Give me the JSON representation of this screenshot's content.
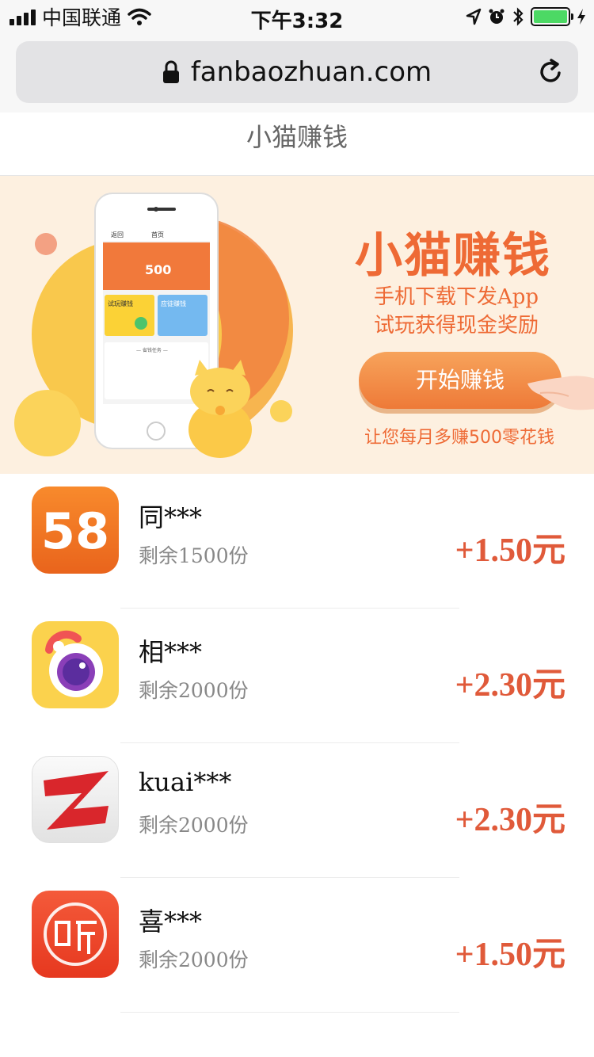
{
  "status_bar": {
    "carrier": "中国联通",
    "time": "下午3:32",
    "battery_color": "#4cd964"
  },
  "browser": {
    "url": "fanbaozhuan.com",
    "lock_icon": "lock-icon",
    "reload_icon": "reload-icon"
  },
  "page": {
    "title": "小猫赚钱"
  },
  "banner": {
    "title": "小猫赚钱",
    "subtitle_line1": "手机下载下发App",
    "subtitle_line2": "试玩获得现金奖励",
    "button_label": "开始赚钱",
    "footer": "让您每月多赚500零花钱",
    "accent_color": "#ee6a35",
    "phone": {
      "back_label": "返回",
      "nav_title": "首页",
      "amount": "500",
      "card1_title": "试玩赚钱",
      "card2_title": "应徒赚钱",
      "section_title": "— 省钱任务 —"
    }
  },
  "tasks": [
    {
      "name": "同***",
      "remaining": "剩余1500份",
      "reward": "+1.50元",
      "icon": "58-app-icon"
    },
    {
      "name": "相***",
      "remaining": "剩余2000份",
      "reward": "+2.30元",
      "icon": "camera-app-icon"
    },
    {
      "name": "kuai***",
      "remaining": "剩余2000份",
      "reward": "+2.30元",
      "icon": "kuaiya-app-icon"
    },
    {
      "name": "喜***",
      "remaining": "剩余2000份",
      "reward": "+1.50元",
      "icon": "ximalaya-app-icon"
    }
  ],
  "colors": {
    "reward": "#e05a3a",
    "banner_bg": "#fdf0e0"
  }
}
